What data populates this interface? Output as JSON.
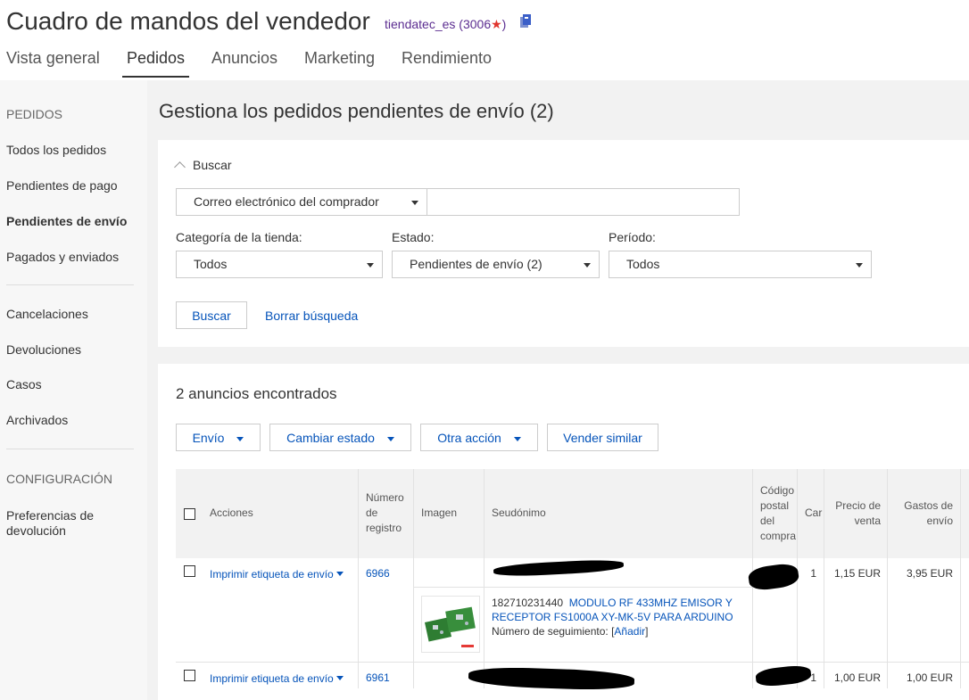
{
  "header": {
    "title": "Cuadro de mandos del vendedor",
    "seller_name": "tiendatec_es",
    "seller_score_open": "(3006",
    "seller_star": "★",
    "seller_score_close": ")",
    "seller_icon": "seller-badge-icon"
  },
  "nav": {
    "tabs": [
      {
        "label": "Vista general"
      },
      {
        "label": "Pedidos"
      },
      {
        "label": "Anuncios"
      },
      {
        "label": "Marketing"
      },
      {
        "label": "Rendimiento"
      }
    ],
    "active": "Pedidos"
  },
  "sidebar": {
    "section_orders": "PEDIDOS",
    "items": [
      {
        "label": "Todos los pedidos"
      },
      {
        "label": "Pendientes de pago"
      },
      {
        "label": "Pendientes de envío"
      },
      {
        "label": "Pagados y enviados"
      },
      {
        "label": "Cancelaciones"
      },
      {
        "label": "Devoluciones"
      },
      {
        "label": "Casos"
      },
      {
        "label": "Archivados"
      }
    ],
    "section_config": "CONFIGURACIÓN",
    "config_item_line1": "Preferencias de",
    "config_item_line2": "devolución"
  },
  "main": {
    "title": "Gestiona los pedidos pendientes de envío (2)",
    "search": {
      "toggle_label": "Buscar",
      "field_select": "Correo electrónico del comprador",
      "field_value": "",
      "store_category_label": "Categoría de la tienda:",
      "store_category_value": "Todos",
      "status_label": "Estado:",
      "status_value": "Pendientes de envío (2)",
      "period_label": "Período:",
      "period_value": "Todos",
      "search_button": "Buscar",
      "clear_link": "Borrar búsqueda"
    },
    "results": {
      "count_text": "2 anuncios encontrados",
      "actions": {
        "shipping": "Envío",
        "change_status": "Cambiar estado",
        "other_action": "Otra acción",
        "sell_similar": "Vender similar"
      },
      "columns": {
        "actions": "Acciones",
        "record_line1": "Número",
        "record_line2": "de",
        "record_line3": "registro",
        "image": "Imagen",
        "nickname": "Seudónimo",
        "postal_line1": "Código",
        "postal_line2": "postal",
        "postal_line3": "del",
        "postal_line4": "compra",
        "quantity": "Car",
        "price_line1": "Precio de",
        "price_line2": "venta",
        "shipping_line1": "Gastos de",
        "shipping_line2": "envío"
      },
      "rows": [
        {
          "action": "Imprimir etiqueta de envío",
          "record": "6966",
          "quantity": "1",
          "price": "1,15 EUR",
          "shipping": "3,95 EUR",
          "item_number": "182710231440",
          "item_title_line1": "MODULO RF 433MHZ EMISOR Y",
          "item_title_line2": "RECEPTOR FS1000A XY-MK-5V PARA ARDUINO",
          "tracking_label": "Número de seguimiento:",
          "tracking_open": "[",
          "tracking_add": "Añadir",
          "tracking_close": "]"
        },
        {
          "action": "Imprimir etiqueta de envío",
          "record": "6961",
          "quantity": "1",
          "price": "1,00 EUR",
          "shipping": "1,00 EUR"
        }
      ]
    }
  },
  "colors": {
    "link": "#0654ba",
    "seller": "#5b2d90",
    "star": "#e0342d"
  }
}
